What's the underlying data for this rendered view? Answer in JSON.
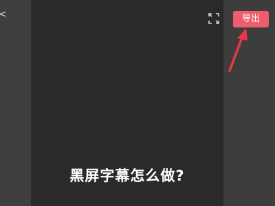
{
  "toolbar": {
    "export_label": "导出",
    "fullscreen_icon": "fullscreen-icon",
    "left_glyph": "<"
  },
  "preview": {
    "subtitle_text": "黑屏字幕怎么做?"
  },
  "colors": {
    "export_button": "#ee5d6e",
    "annotation_arrow": "#e8394a",
    "preview_background": "#2a2a2a",
    "side_panel": "#3d3d3d"
  }
}
